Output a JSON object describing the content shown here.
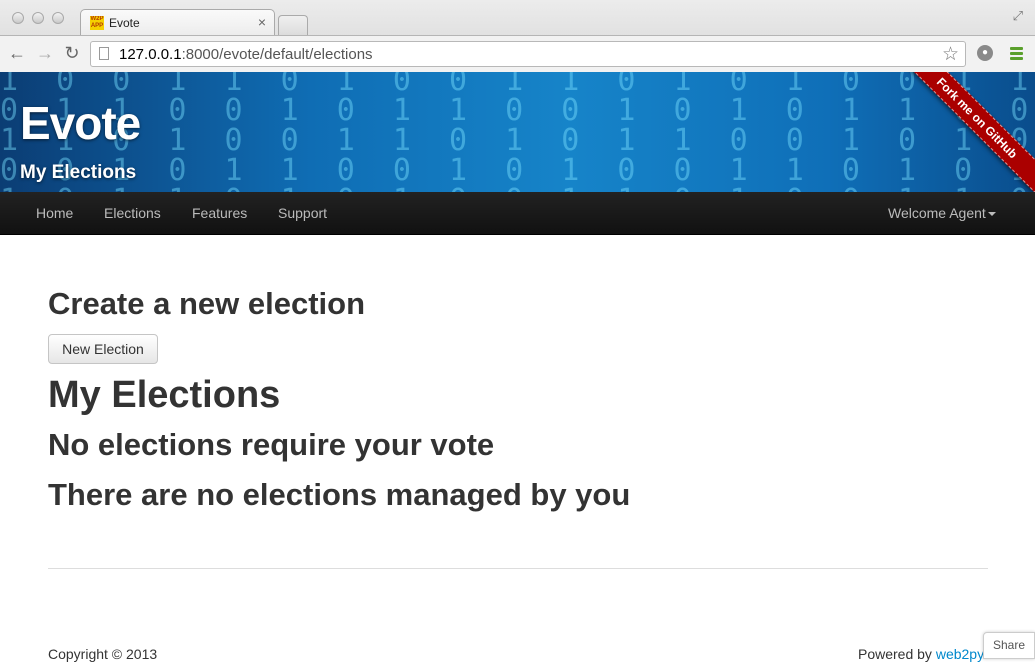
{
  "browser": {
    "tab_title": "Evote",
    "favicon_text": "W2P APP",
    "tab_close": "×",
    "url_host": "127.0.0.1",
    "url_path": ":8000/evote/default/elections",
    "back_icon": "←",
    "forward_icon": "→",
    "reload_icon": "↻",
    "star_icon": "☆",
    "resize_icon": "⤢"
  },
  "header": {
    "brand": "Evote",
    "subtitle": "My Elections",
    "ribbon": "Fork me on GitHub",
    "accent": "#1684c9",
    "ribbon_color": "#aa0000"
  },
  "navbar": {
    "items": [
      "Home",
      "Elections",
      "Features",
      "Support"
    ],
    "welcome": "Welcome Agent"
  },
  "main": {
    "create_heading": "Create a new election",
    "new_button": "New Election",
    "my_heading": "My Elections",
    "vote_status": "No elections require your vote",
    "managed_status": "There are no elections managed by you"
  },
  "footer": {
    "copyright": "Copyright © 2013",
    "powered_prefix": "Powered by ",
    "powered_link": "web2py",
    "share": "Share"
  }
}
